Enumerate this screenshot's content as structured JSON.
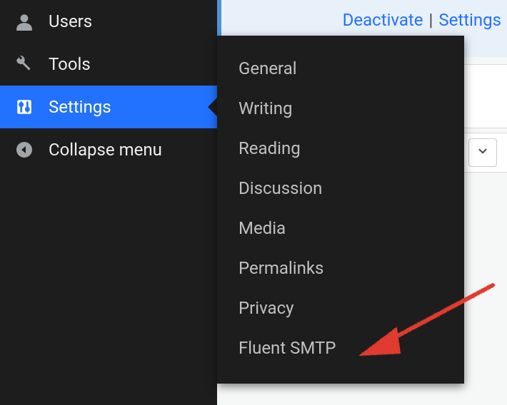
{
  "sidebar": {
    "items": [
      {
        "label": "Users",
        "icon": "user-icon",
        "active": false
      },
      {
        "label": "Tools",
        "icon": "wrench-icon",
        "active": false
      },
      {
        "label": "Settings",
        "icon": "sliders-icon",
        "active": true
      },
      {
        "label": "Collapse menu",
        "icon": "collapse-icon",
        "active": false
      }
    ]
  },
  "submenu": {
    "items": [
      {
        "label": "General"
      },
      {
        "label": "Writing"
      },
      {
        "label": "Reading"
      },
      {
        "label": "Discussion"
      },
      {
        "label": "Media"
      },
      {
        "label": "Permalinks"
      },
      {
        "label": "Privacy"
      },
      {
        "label": "Fluent SMTP"
      }
    ]
  },
  "plugin_actions": {
    "deactivate": "Deactivate",
    "separator": "|",
    "settings": "Settings"
  },
  "annotation": {
    "target": "Fluent SMTP",
    "color": "#e03a2f"
  }
}
